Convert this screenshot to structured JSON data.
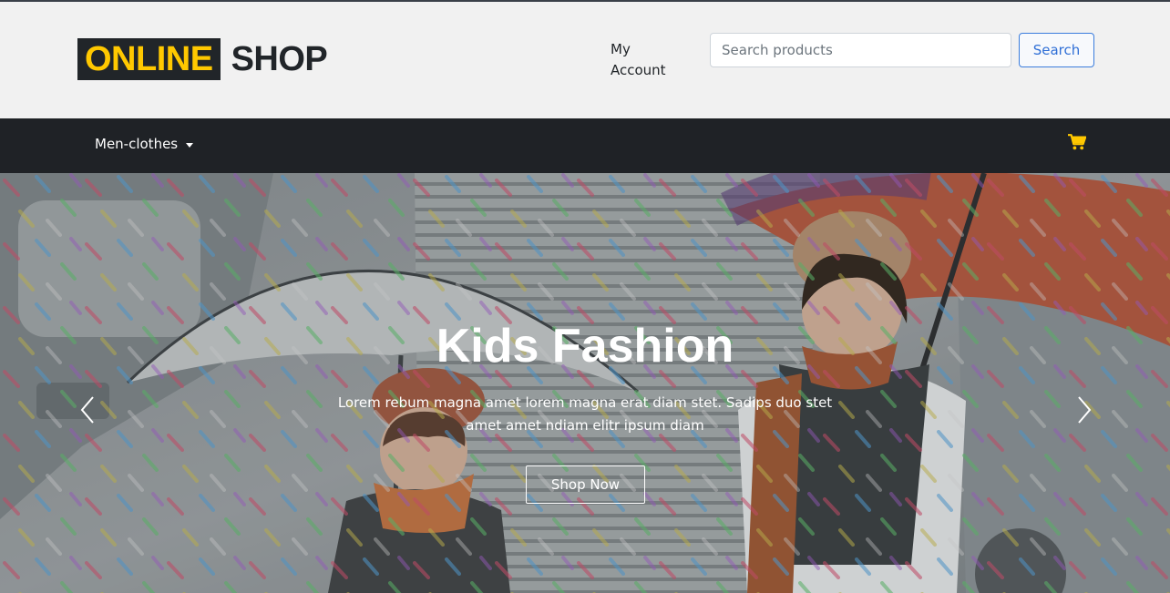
{
  "header": {
    "logo_part1": "ONLINE",
    "logo_part2": "SHOP",
    "account_label": "My Account",
    "search_placeholder": "Search products",
    "search_button": "Search"
  },
  "nav": {
    "dropdown_label": "Men-clothes",
    "cart_icon": "shopping-cart-icon"
  },
  "hero": {
    "title": "Kids Fashion",
    "text": "Lorem rebum magna amet lorem magna erat diam stet. Sadips duo stet amet amet ndiam elitr ipsum diam",
    "button": "Shop Now",
    "prev_icon": "chevron-left-icon",
    "next_icon": "chevron-right-icon"
  },
  "colors": {
    "accent_yellow": "#ffc800",
    "dark": "#212529",
    "link_blue": "#2f6fd6"
  }
}
